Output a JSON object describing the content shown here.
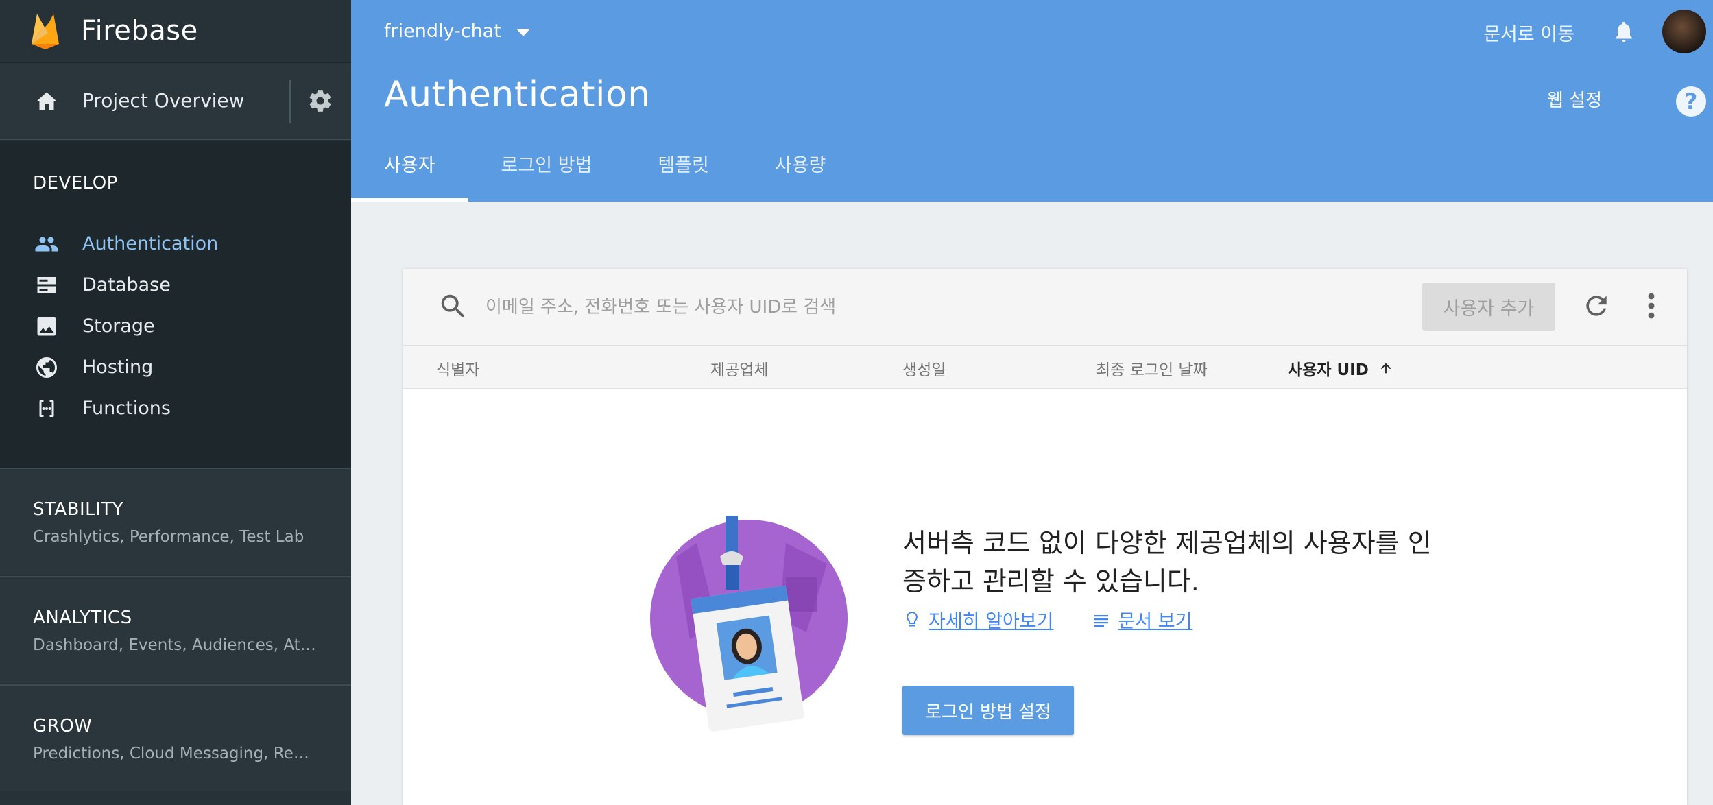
{
  "app": {
    "brand": "Firebase",
    "project_name": "friendly-chat",
    "docs_link": "문서로 이동"
  },
  "sidebar": {
    "overview_label": "Project Overview",
    "develop_title": "DEVELOP",
    "develop_items": [
      {
        "label": "Authentication",
        "icon": "people-icon",
        "active": true
      },
      {
        "label": "Database",
        "icon": "database-icon",
        "active": false
      },
      {
        "label": "Storage",
        "icon": "image-icon",
        "active": false
      },
      {
        "label": "Hosting",
        "icon": "globe-icon",
        "active": false
      },
      {
        "label": "Functions",
        "icon": "functions-icon",
        "active": false
      }
    ],
    "sections": [
      {
        "title": "STABILITY",
        "subtitle": "Crashlytics, Performance, Test Lab"
      },
      {
        "title": "ANALYTICS",
        "subtitle": "Dashboard, Events, Audiences, Attrib..."
      },
      {
        "title": "GROW",
        "subtitle": "Predictions, Cloud Messaging, Remo..."
      }
    ]
  },
  "header": {
    "title": "Authentication",
    "web_setup": "웹 설정",
    "help": "?",
    "tabs": [
      {
        "label": "사용자",
        "active": true
      },
      {
        "label": "로그인 방법",
        "active": false
      },
      {
        "label": "템플릿",
        "active": false
      },
      {
        "label": "사용량",
        "active": false
      }
    ]
  },
  "users": {
    "search_placeholder": "이메일 주소, 전화번호 또는 사용자 UID로 검색",
    "add_user": "사용자 추가",
    "columns": [
      "식별자",
      "제공업체",
      "생성일",
      "최종 로그인 날짜",
      "사용자 UID"
    ],
    "sorted_column": "사용자 UID",
    "empty": {
      "message": "서버측 코드 없이 다양한 제공업체의 사용자를 인증하고 관리할 수 있습니다.",
      "learn_more": "자세히 알아보기",
      "view_docs": "문서 보기",
      "cta": "로그인 방법 설정"
    }
  },
  "colors": {
    "header_blue": "#5a9be1",
    "sidebar_dark": "#263238",
    "sidebar_active": "#8ec3f2",
    "link_blue": "#4285f4"
  }
}
